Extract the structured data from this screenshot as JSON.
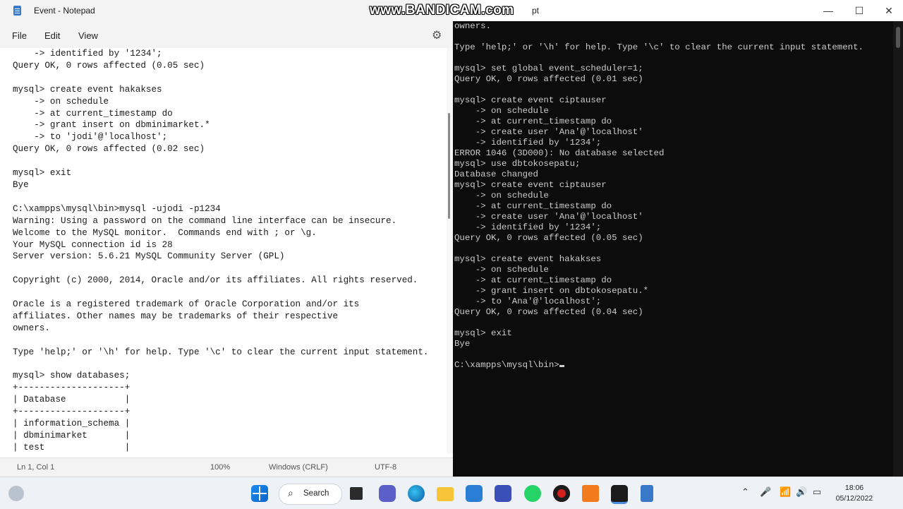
{
  "notepad": {
    "title": "Event - Notepad",
    "menu": [
      "File",
      "Edit",
      "View"
    ],
    "lines": [
      "    -> identified by '1234';",
      "Query OK, 0 rows affected (0.05 sec)",
      "",
      "mysql> create event hakakses",
      "    -> on schedule",
      "    -> at current_timestamp do",
      "    -> grant insert on dbminimarket.*",
      "    -> to 'jodi'@'localhost';",
      "Query OK, 0 rows affected (0.02 sec)",
      "",
      "mysql> exit",
      "Bye",
      "",
      "C:\\xampps\\mysql\\bin>mysql -ujodi -p1234",
      "Warning: Using a password on the command line interface can be insecure.",
      "Welcome to the MySQL monitor.  Commands end with ; or \\g.",
      "Your MySQL connection id is 28",
      "Server version: 5.6.21 MySQL Community Server (GPL)",
      "",
      "Copyright (c) 2000, 2014, Oracle and/or its affiliates. All rights reserved.",
      "",
      "Oracle is a registered trademark of Oracle Corporation and/or its",
      "affiliates. Other names may be trademarks of their respective",
      "owners.",
      "",
      "Type 'help;' or '\\h' for help. Type '\\c' to clear the current input statement.",
      "",
      "mysql> show databases;",
      "+--------------------+",
      "| Database           |",
      "+--------------------+",
      "| information_schema |",
      "| dbminimarket       |",
      "| test               |"
    ],
    "status": {
      "position": "Ln 1, Col 1",
      "zoom": "100%",
      "line_ending": "Windows (CRLF)",
      "encoding": "UTF-8"
    }
  },
  "cmd": {
    "title_suffix": "pt",
    "watermark": "www.BANDICAM.com",
    "lines": [
      "owners.",
      "",
      "Type 'help;' or '\\h' for help. Type '\\c' to clear the current input statement.",
      "",
      "mysql> set global event_scheduler=1;",
      "Query OK, 0 rows affected (0.01 sec)",
      "",
      "mysql> create event ciptauser",
      "    -> on schedule",
      "    -> at current_timestamp do",
      "    -> create user 'Ana'@'localhost'",
      "    -> identified by '1234';",
      "ERROR 1046 (3D000): No database selected",
      "mysql> use dbtokosepatu;",
      "Database changed",
      "mysql> create event ciptauser",
      "    -> on schedule",
      "    -> at current_timestamp do",
      "    -> create user 'Ana'@'localhost'",
      "    -> identified by '1234';",
      "Query OK, 0 rows affected (0.05 sec)",
      "",
      "mysql> create event hakakses",
      "    -> on schedule",
      "    -> at current_timestamp do",
      "    -> grant insert on dbtokosepatu.*",
      "    -> to 'Ana'@'localhost';",
      "Query OK, 0 rows affected (0.04 sec)",
      "",
      "mysql> exit",
      "Bye",
      ""
    ],
    "prompt": "C:\\xampps\\mysql\\bin>"
  },
  "taskbar": {
    "search_label": "Search",
    "time": "18:06",
    "date": "05/12/2022"
  }
}
